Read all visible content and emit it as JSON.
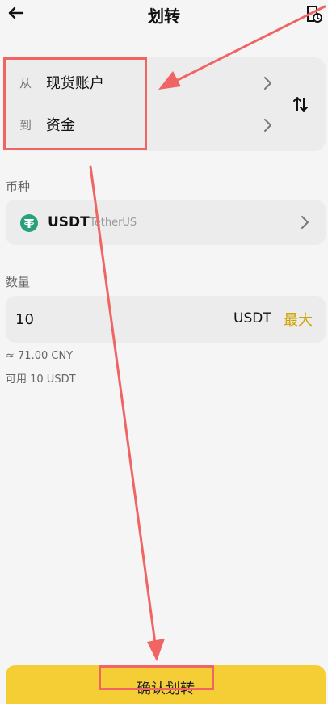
{
  "header": {
    "title": "划转",
    "back_icon": "arrow-left-icon",
    "history_icon": "transfer-history-icon"
  },
  "transfer": {
    "from_label": "从",
    "from_value": "现货账户",
    "to_label": "到",
    "to_value": "资金",
    "swap_icon": "swap-vertical-icon"
  },
  "currency": {
    "label": "币种",
    "symbol": "USDT",
    "name": "TetherUS",
    "logo_icon": "tether-icon"
  },
  "amount": {
    "label": "数量",
    "value": "10",
    "unit": "USDT",
    "max_label": "最大",
    "approx_value": "≈ 71.00 CNY",
    "available_text": "可用 10 USDT"
  },
  "action": {
    "confirm_label": "确认划转"
  },
  "colors": {
    "accent": "#f5ce35",
    "max_text": "#d0a300",
    "annotation": "#f06464",
    "tether": "#26a17b"
  }
}
